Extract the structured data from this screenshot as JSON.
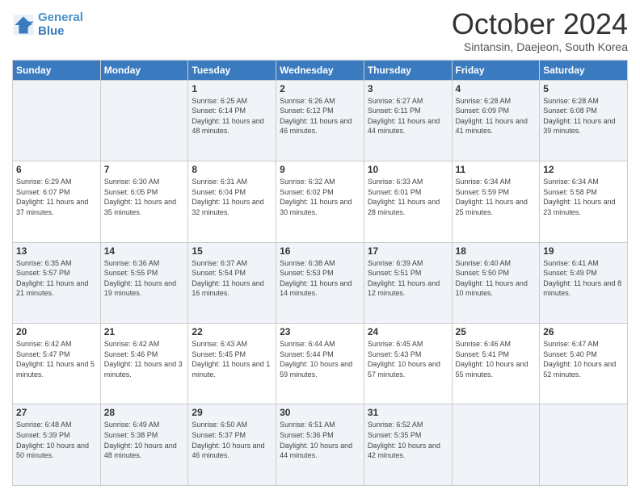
{
  "logo": {
    "line1": "General",
    "line2": "Blue"
  },
  "title": "October 2024",
  "subtitle": "Sintansin, Daejeon, South Korea",
  "days_of_week": [
    "Sunday",
    "Monday",
    "Tuesday",
    "Wednesday",
    "Thursday",
    "Friday",
    "Saturday"
  ],
  "weeks": [
    [
      {
        "day": "",
        "sunrise": "",
        "sunset": "",
        "daylight": "",
        "empty": true
      },
      {
        "day": "",
        "sunrise": "",
        "sunset": "",
        "daylight": "",
        "empty": true
      },
      {
        "day": "1",
        "sunrise": "Sunrise: 6:25 AM",
        "sunset": "Sunset: 6:14 PM",
        "daylight": "Daylight: 11 hours and 48 minutes."
      },
      {
        "day": "2",
        "sunrise": "Sunrise: 6:26 AM",
        "sunset": "Sunset: 6:12 PM",
        "daylight": "Daylight: 11 hours and 46 minutes."
      },
      {
        "day": "3",
        "sunrise": "Sunrise: 6:27 AM",
        "sunset": "Sunset: 6:11 PM",
        "daylight": "Daylight: 11 hours and 44 minutes."
      },
      {
        "day": "4",
        "sunrise": "Sunrise: 6:28 AM",
        "sunset": "Sunset: 6:09 PM",
        "daylight": "Daylight: 11 hours and 41 minutes."
      },
      {
        "day": "5",
        "sunrise": "Sunrise: 6:28 AM",
        "sunset": "Sunset: 6:08 PM",
        "daylight": "Daylight: 11 hours and 39 minutes."
      }
    ],
    [
      {
        "day": "6",
        "sunrise": "Sunrise: 6:29 AM",
        "sunset": "Sunset: 6:07 PM",
        "daylight": "Daylight: 11 hours and 37 minutes."
      },
      {
        "day": "7",
        "sunrise": "Sunrise: 6:30 AM",
        "sunset": "Sunset: 6:05 PM",
        "daylight": "Daylight: 11 hours and 35 minutes."
      },
      {
        "day": "8",
        "sunrise": "Sunrise: 6:31 AM",
        "sunset": "Sunset: 6:04 PM",
        "daylight": "Daylight: 11 hours and 32 minutes."
      },
      {
        "day": "9",
        "sunrise": "Sunrise: 6:32 AM",
        "sunset": "Sunset: 6:02 PM",
        "daylight": "Daylight: 11 hours and 30 minutes."
      },
      {
        "day": "10",
        "sunrise": "Sunrise: 6:33 AM",
        "sunset": "Sunset: 6:01 PM",
        "daylight": "Daylight: 11 hours and 28 minutes."
      },
      {
        "day": "11",
        "sunrise": "Sunrise: 6:34 AM",
        "sunset": "Sunset: 5:59 PM",
        "daylight": "Daylight: 11 hours and 25 minutes."
      },
      {
        "day": "12",
        "sunrise": "Sunrise: 6:34 AM",
        "sunset": "Sunset: 5:58 PM",
        "daylight": "Daylight: 11 hours and 23 minutes."
      }
    ],
    [
      {
        "day": "13",
        "sunrise": "Sunrise: 6:35 AM",
        "sunset": "Sunset: 5:57 PM",
        "daylight": "Daylight: 11 hours and 21 minutes."
      },
      {
        "day": "14",
        "sunrise": "Sunrise: 6:36 AM",
        "sunset": "Sunset: 5:55 PM",
        "daylight": "Daylight: 11 hours and 19 minutes."
      },
      {
        "day": "15",
        "sunrise": "Sunrise: 6:37 AM",
        "sunset": "Sunset: 5:54 PM",
        "daylight": "Daylight: 11 hours and 16 minutes."
      },
      {
        "day": "16",
        "sunrise": "Sunrise: 6:38 AM",
        "sunset": "Sunset: 5:53 PM",
        "daylight": "Daylight: 11 hours and 14 minutes."
      },
      {
        "day": "17",
        "sunrise": "Sunrise: 6:39 AM",
        "sunset": "Sunset: 5:51 PM",
        "daylight": "Daylight: 11 hours and 12 minutes."
      },
      {
        "day": "18",
        "sunrise": "Sunrise: 6:40 AM",
        "sunset": "Sunset: 5:50 PM",
        "daylight": "Daylight: 11 hours and 10 minutes."
      },
      {
        "day": "19",
        "sunrise": "Sunrise: 6:41 AM",
        "sunset": "Sunset: 5:49 PM",
        "daylight": "Daylight: 11 hours and 8 minutes."
      }
    ],
    [
      {
        "day": "20",
        "sunrise": "Sunrise: 6:42 AM",
        "sunset": "Sunset: 5:47 PM",
        "daylight": "Daylight: 11 hours and 5 minutes."
      },
      {
        "day": "21",
        "sunrise": "Sunrise: 6:42 AM",
        "sunset": "Sunset: 5:46 PM",
        "daylight": "Daylight: 11 hours and 3 minutes."
      },
      {
        "day": "22",
        "sunrise": "Sunrise: 6:43 AM",
        "sunset": "Sunset: 5:45 PM",
        "daylight": "Daylight: 11 hours and 1 minute."
      },
      {
        "day": "23",
        "sunrise": "Sunrise: 6:44 AM",
        "sunset": "Sunset: 5:44 PM",
        "daylight": "Daylight: 10 hours and 59 minutes."
      },
      {
        "day": "24",
        "sunrise": "Sunrise: 6:45 AM",
        "sunset": "Sunset: 5:43 PM",
        "daylight": "Daylight: 10 hours and 57 minutes."
      },
      {
        "day": "25",
        "sunrise": "Sunrise: 6:46 AM",
        "sunset": "Sunset: 5:41 PM",
        "daylight": "Daylight: 10 hours and 55 minutes."
      },
      {
        "day": "26",
        "sunrise": "Sunrise: 6:47 AM",
        "sunset": "Sunset: 5:40 PM",
        "daylight": "Daylight: 10 hours and 52 minutes."
      }
    ],
    [
      {
        "day": "27",
        "sunrise": "Sunrise: 6:48 AM",
        "sunset": "Sunset: 5:39 PM",
        "daylight": "Daylight: 10 hours and 50 minutes."
      },
      {
        "day": "28",
        "sunrise": "Sunrise: 6:49 AM",
        "sunset": "Sunset: 5:38 PM",
        "daylight": "Daylight: 10 hours and 48 minutes."
      },
      {
        "day": "29",
        "sunrise": "Sunrise: 6:50 AM",
        "sunset": "Sunset: 5:37 PM",
        "daylight": "Daylight: 10 hours and 46 minutes."
      },
      {
        "day": "30",
        "sunrise": "Sunrise: 6:51 AM",
        "sunset": "Sunset: 5:36 PM",
        "daylight": "Daylight: 10 hours and 44 minutes."
      },
      {
        "day": "31",
        "sunrise": "Sunrise: 6:52 AM",
        "sunset": "Sunset: 5:35 PM",
        "daylight": "Daylight: 10 hours and 42 minutes."
      },
      {
        "day": "",
        "sunrise": "",
        "sunset": "",
        "daylight": "",
        "empty": true
      },
      {
        "day": "",
        "sunrise": "",
        "sunset": "",
        "daylight": "",
        "empty": true
      }
    ]
  ]
}
